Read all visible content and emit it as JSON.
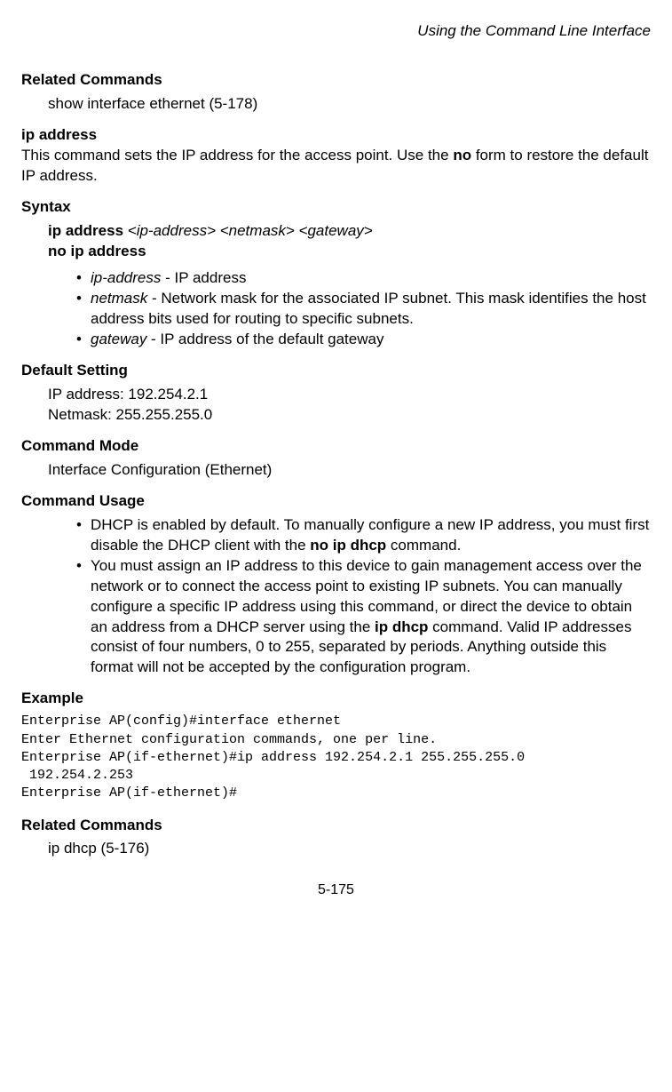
{
  "header": {
    "title": "Using the Command Line Interface"
  },
  "sections": {
    "relatedCommands1": {
      "heading": "Related Commands",
      "text": "show interface ethernet (5-178)"
    },
    "ipAddress": {
      "title": "ip address",
      "desc1": "This command sets the IP address for the access point. Use the ",
      "descBold": "no",
      "desc2": " form to restore the default IP address."
    },
    "syntax": {
      "heading": "Syntax",
      "line1_b": "ip address ",
      "line1_i": "<ip-address> <netmask> <gateway>",
      "line2_b": "no ip address",
      "items": {
        "a1_i": "ip-address",
        "a1_t": " - IP address",
        "a2_i": "netmask",
        "a2_t": " - Network mask for the associated IP subnet. This mask identifies the host address bits used for routing to specific subnets.",
        "a3_i": "gateway",
        "a3_t": " - IP address of the default gateway"
      }
    },
    "defaultSetting": {
      "heading": "Default Setting",
      "line1": "IP address: 192.254.2.1",
      "line2": "Netmask: 255.255.255.0"
    },
    "commandMode": {
      "heading": "Command Mode",
      "text": "Interface Configuration (Ethernet)"
    },
    "commandUsage": {
      "heading": "Command Usage",
      "item1_a": "DHCP is enabled by default. To manually configure a new IP address, you must first disable the DHCP client with the ",
      "item1_b": "no ip dhcp",
      "item1_c": " command.",
      "item2_a": "You must assign an IP address to this device to gain management access over the network or to connect the access point to existing IP subnets. You can manually configure a specific IP address using this command, or direct the device to obtain an address from a DHCP server using the ",
      "item2_b": "ip dhcp",
      "item2_c": " command. Valid IP addresses consist of four numbers, 0 to 255, separated by periods. Anything outside this format will not be accepted by the configuration program."
    },
    "example": {
      "heading": "Example",
      "code": "Enterprise AP(config)#interface ethernet\nEnter Ethernet configuration commands, one per line.\nEnterprise AP(if-ethernet)#ip address 192.254.2.1 255.255.255.0 \n 192.254.2.253\nEnterprise AP(if-ethernet)#"
    },
    "relatedCommands2": {
      "heading": "Related Commands",
      "text": "ip dhcp (5-176)"
    }
  },
  "footer": {
    "pageNum": "5-175"
  }
}
